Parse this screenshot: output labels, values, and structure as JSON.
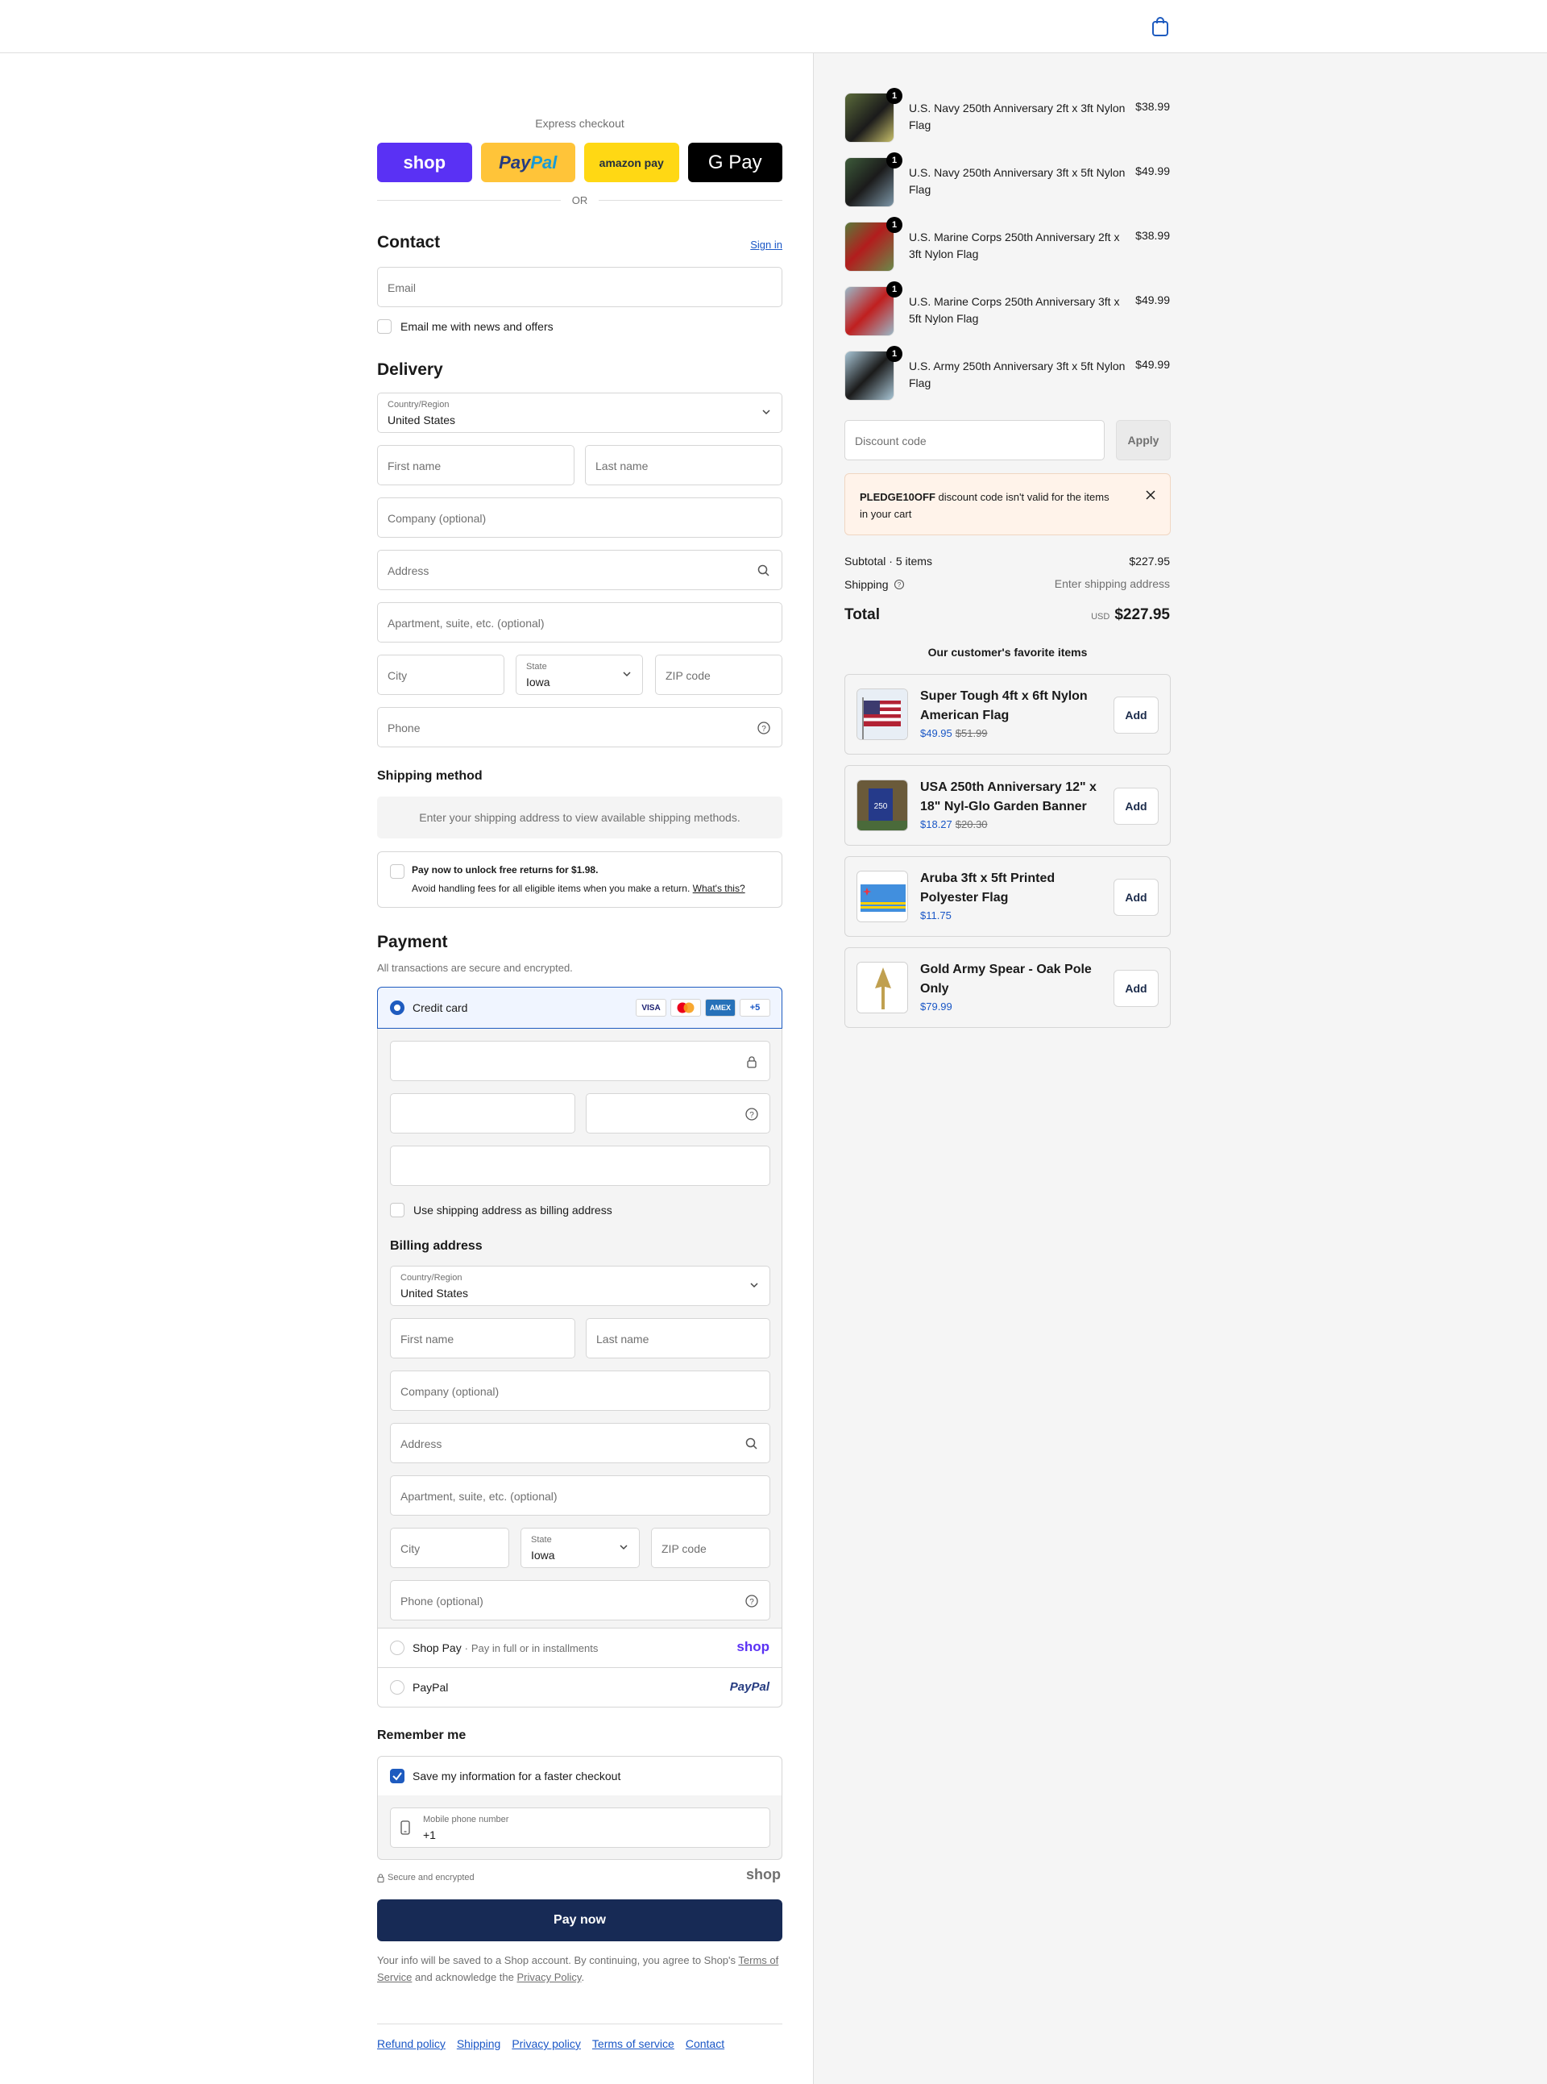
{
  "header": {
    "cart_icon": "shopping-bag-icon"
  },
  "express": {
    "title": "Express checkout",
    "shop_label": "shop",
    "paypal_label_a": "Pay",
    "paypal_label_b": "Pal",
    "amazon_label": "amazon pay",
    "gpay_label": "G Pay",
    "or_label": "OR"
  },
  "contact": {
    "heading": "Contact",
    "signin_label": "Sign in",
    "email_placeholder": "Email",
    "newsletter_label": "Email me with news and offers"
  },
  "delivery": {
    "heading": "Delivery",
    "country_label": "Country/Region",
    "country_value": "United States",
    "first_name": "First name",
    "last_name": "Last name",
    "company": "Company (optional)",
    "address": "Address",
    "apartment": "Apartment, suite, etc. (optional)",
    "city": "City",
    "state_label": "State",
    "state_value": "Iowa",
    "zip": "ZIP code",
    "phone": "Phone"
  },
  "shipping_method": {
    "heading": "Shipping method",
    "notice": "Enter your shipping address to view available shipping methods.",
    "returns_title": "Pay now to unlock free returns for $1.98.",
    "returns_text": "Avoid handling fees for all eligible items when you make a return.",
    "returns_link": "What's this?"
  },
  "payment": {
    "heading": "Payment",
    "subtitle": "All transactions are secure and encrypted.",
    "credit_card_label": "Credit card",
    "card_logos": [
      "VISA",
      "MC",
      "AMEX",
      "+5"
    ],
    "use_shipping_label": "Use shipping address as billing address",
    "billing_heading": "Billing address",
    "billing": {
      "country_label": "Country/Region",
      "country_value": "United States",
      "first_name": "First name",
      "last_name": "Last name",
      "company": "Company (optional)",
      "address": "Address",
      "apartment": "Apartment, suite, etc. (optional)",
      "city": "City",
      "state_label": "State",
      "state_value": "Iowa",
      "zip": "ZIP code",
      "phone": "Phone (optional)"
    },
    "shoppay_label": "Shop Pay",
    "shoppay_sub": "Pay in full or in installments",
    "shoppay_logo": "shop",
    "paypal_label": "PayPal",
    "paypal_logo": "PayPal"
  },
  "remember": {
    "heading": "Remember me",
    "save_label": "Save my information for a faster checkout",
    "mobile_label": "Mobile phone number",
    "mobile_value": "+1",
    "secure_label": "Secure and encrypted",
    "shop_logo": "shop"
  },
  "pay_button": "Pay now",
  "legal": {
    "text_a": "Your info will be saved to a Shop account. By continuing, you agree to Shop's",
    "terms": "Terms of Service",
    "text_b": "and acknowledge the",
    "privacy": "Privacy Policy",
    "text_c": "."
  },
  "footer": [
    "Refund policy",
    "Shipping",
    "Privacy policy",
    "Terms of service",
    "Contact"
  ],
  "cart": {
    "items": [
      {
        "name": "U.S. Navy 250th Anniversary 2ft x 3ft Nylon Flag",
        "price": "$38.99",
        "qty": "1"
      },
      {
        "name": "U.S. Navy 250th Anniversary 3ft x 5ft Nylon Flag",
        "price": "$49.99",
        "qty": "1"
      },
      {
        "name": "U.S. Marine Corps 250th Anniversary 2ft x 3ft Nylon Flag",
        "price": "$38.99",
        "qty": "1"
      },
      {
        "name": "U.S. Marine Corps 250th Anniversary 3ft x 5ft Nylon Flag",
        "price": "$49.99",
        "qty": "1"
      },
      {
        "name": "U.S. Army 250th Anniversary 3ft x 5ft Nylon Flag",
        "price": "$49.99",
        "qty": "1"
      }
    ],
    "discount_placeholder": "Discount code",
    "apply_label": "Apply",
    "alert_code": "PLEDGE10OFF",
    "alert_text": "discount code isn't valid for the items in your cart",
    "subtotal_label": "Subtotal · 5 items",
    "subtotal_value": "$227.95",
    "shipping_label": "Shipping",
    "shipping_value": "Enter shipping address",
    "total_label": "Total",
    "currency": "USD",
    "total_value": "$227.95"
  },
  "favorites": {
    "heading": "Our customer's favorite items",
    "items": [
      {
        "title": "Super Tough 4ft x 6ft Nylon American Flag",
        "price": "$49.95",
        "old_price": "$51.99",
        "add": "Add"
      },
      {
        "title": "USA 250th Anniversary 12\" x 18\" Nyl-Glo Garden Banner",
        "price": "$18.27",
        "old_price": "$20.30",
        "add": "Add"
      },
      {
        "title": "Aruba 3ft x 5ft Printed Polyester Flag",
        "price": "$11.75",
        "old_price": "",
        "add": "Add"
      },
      {
        "title": "Gold Army Spear - Oak Pole Only",
        "price": "$79.99",
        "old_price": "",
        "add": "Add"
      }
    ]
  },
  "colors": {
    "accent": "#1e5bbf",
    "pay_button": "#172a55",
    "shop_purple": "#5a31f4"
  }
}
